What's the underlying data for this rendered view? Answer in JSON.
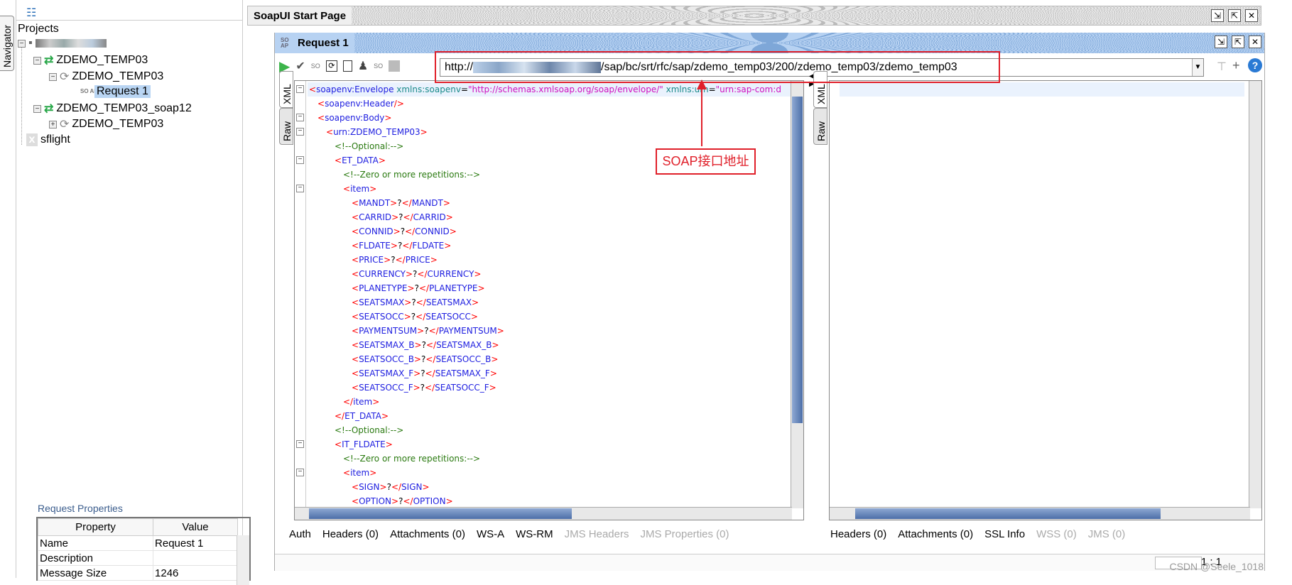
{
  "navigator": {
    "tab_label": "Navigator",
    "projects_label": "Projects",
    "tree": [
      {
        "label": "",
        "icon": "project-icon",
        "blurred": true
      },
      {
        "label": "ZDEMO_TEMP03",
        "icon": "interface-icon"
      },
      {
        "label": "ZDEMO_TEMP03",
        "icon": "operation-icon"
      },
      {
        "label": "Request 1",
        "icon": "soap-request-icon",
        "selected": true
      },
      {
        "label": "ZDEMO_TEMP03_soap12",
        "icon": "interface-icon"
      },
      {
        "label": "ZDEMO_TEMP03",
        "icon": "operation-icon"
      },
      {
        "label": "sflight",
        "icon": "closed-project-icon"
      }
    ]
  },
  "properties": {
    "title": "Request Properties",
    "headers": [
      "Property",
      "Value"
    ],
    "rows": [
      [
        "Name",
        "Request 1"
      ],
      [
        "Description",
        ""
      ],
      [
        "Message Size",
        "1246"
      ]
    ]
  },
  "start_page": {
    "title": "SoapUI Start Page"
  },
  "request": {
    "title": "Request 1",
    "soap_badge": "SO AP",
    "url_prefix": "http://",
    "url_suffix": "/sap/bc/srt/rfc/sap/zdemo_temp03/200/zdemo_temp03/zdemo_temp03",
    "annotation": "SOAP接口地址",
    "annotation_color": "#e0202a",
    "left_vtabs": [
      "XML",
      "Raw"
    ],
    "right_vtabs": [
      "XML",
      "Raw"
    ],
    "xml_lines": [
      {
        "indent": 0,
        "fold": true,
        "tokens": [
          [
            "b",
            "<"
          ],
          [
            "n",
            "soapenv:Envelope "
          ],
          [
            "a",
            "xmlns:soapenv"
          ],
          [
            "x",
            "="
          ],
          [
            "v",
            "\"http://schemas.xmlsoap.org/soap/envelope/\" "
          ],
          [
            "a",
            "xmlns:urn"
          ],
          [
            "x",
            "="
          ],
          [
            "v",
            "\"urn:sap-com:d"
          ]
        ]
      },
      {
        "indent": 1,
        "fold": false,
        "tokens": [
          [
            "b",
            "<"
          ],
          [
            "n",
            "soapenv:Header"
          ],
          [
            "b",
            "/>"
          ]
        ]
      },
      {
        "indent": 1,
        "fold": true,
        "tokens": [
          [
            "b",
            "<"
          ],
          [
            "n",
            "soapenv:Body"
          ],
          [
            "b",
            ">"
          ]
        ]
      },
      {
        "indent": 2,
        "fold": true,
        "tokens": [
          [
            "b",
            "<"
          ],
          [
            "n",
            "urn:ZDEMO_TEMP03"
          ],
          [
            "b",
            ">"
          ]
        ]
      },
      {
        "indent": 3,
        "fold": false,
        "tokens": [
          [
            "c",
            "<!--Optional:-->"
          ]
        ]
      },
      {
        "indent": 3,
        "fold": true,
        "tokens": [
          [
            "b",
            "<"
          ],
          [
            "n",
            "ET_DATA"
          ],
          [
            "b",
            ">"
          ]
        ]
      },
      {
        "indent": 4,
        "fold": false,
        "tokens": [
          [
            "c",
            "<!--Zero or more repetitions:-->"
          ]
        ]
      },
      {
        "indent": 4,
        "fold": true,
        "tokens": [
          [
            "b",
            "<"
          ],
          [
            "n",
            "item"
          ],
          [
            "b",
            ">"
          ]
        ]
      },
      {
        "indent": 5,
        "fold": false,
        "tokens": [
          [
            "b",
            "<"
          ],
          [
            "n",
            "MANDT"
          ],
          [
            "b",
            ">"
          ],
          [
            "x",
            "?"
          ],
          [
            "b",
            "</"
          ],
          [
            "n",
            "MANDT"
          ],
          [
            "b",
            ">"
          ]
        ]
      },
      {
        "indent": 5,
        "fold": false,
        "tokens": [
          [
            "b",
            "<"
          ],
          [
            "n",
            "CARRID"
          ],
          [
            "b",
            ">"
          ],
          [
            "x",
            "?"
          ],
          [
            "b",
            "</"
          ],
          [
            "n",
            "CARRID"
          ],
          [
            "b",
            ">"
          ]
        ]
      },
      {
        "indent": 5,
        "fold": false,
        "tokens": [
          [
            "b",
            "<"
          ],
          [
            "n",
            "CONNID"
          ],
          [
            "b",
            ">"
          ],
          [
            "x",
            "?"
          ],
          [
            "b",
            "</"
          ],
          [
            "n",
            "CONNID"
          ],
          [
            "b",
            ">"
          ]
        ]
      },
      {
        "indent": 5,
        "fold": false,
        "tokens": [
          [
            "b",
            "<"
          ],
          [
            "n",
            "FLDATE"
          ],
          [
            "b",
            ">"
          ],
          [
            "x",
            "?"
          ],
          [
            "b",
            "</"
          ],
          [
            "n",
            "FLDATE"
          ],
          [
            "b",
            ">"
          ]
        ]
      },
      {
        "indent": 5,
        "fold": false,
        "tokens": [
          [
            "b",
            "<"
          ],
          [
            "n",
            "PRICE"
          ],
          [
            "b",
            ">"
          ],
          [
            "x",
            "?"
          ],
          [
            "b",
            "</"
          ],
          [
            "n",
            "PRICE"
          ],
          [
            "b",
            ">"
          ]
        ]
      },
      {
        "indent": 5,
        "fold": false,
        "tokens": [
          [
            "b",
            "<"
          ],
          [
            "n",
            "CURRENCY"
          ],
          [
            "b",
            ">"
          ],
          [
            "x",
            "?"
          ],
          [
            "b",
            "</"
          ],
          [
            "n",
            "CURRENCY"
          ],
          [
            "b",
            ">"
          ]
        ]
      },
      {
        "indent": 5,
        "fold": false,
        "tokens": [
          [
            "b",
            "<"
          ],
          [
            "n",
            "PLANETYPE"
          ],
          [
            "b",
            ">"
          ],
          [
            "x",
            "?"
          ],
          [
            "b",
            "</"
          ],
          [
            "n",
            "PLANETYPE"
          ],
          [
            "b",
            ">"
          ]
        ]
      },
      {
        "indent": 5,
        "fold": false,
        "tokens": [
          [
            "b",
            "<"
          ],
          [
            "n",
            "SEATSMAX"
          ],
          [
            "b",
            ">"
          ],
          [
            "x",
            "?"
          ],
          [
            "b",
            "</"
          ],
          [
            "n",
            "SEATSMAX"
          ],
          [
            "b",
            ">"
          ]
        ]
      },
      {
        "indent": 5,
        "fold": false,
        "tokens": [
          [
            "b",
            "<"
          ],
          [
            "n",
            "SEATSOCC"
          ],
          [
            "b",
            ">"
          ],
          [
            "x",
            "?"
          ],
          [
            "b",
            "</"
          ],
          [
            "n",
            "SEATSOCC"
          ],
          [
            "b",
            ">"
          ]
        ]
      },
      {
        "indent": 5,
        "fold": false,
        "tokens": [
          [
            "b",
            "<"
          ],
          [
            "n",
            "PAYMENTSUM"
          ],
          [
            "b",
            ">"
          ],
          [
            "x",
            "?"
          ],
          [
            "b",
            "</"
          ],
          [
            "n",
            "PAYMENTSUM"
          ],
          [
            "b",
            ">"
          ]
        ]
      },
      {
        "indent": 5,
        "fold": false,
        "tokens": [
          [
            "b",
            "<"
          ],
          [
            "n",
            "SEATSMAX_B"
          ],
          [
            "b",
            ">"
          ],
          [
            "x",
            "?"
          ],
          [
            "b",
            "</"
          ],
          [
            "n",
            "SEATSMAX_B"
          ],
          [
            "b",
            ">"
          ]
        ]
      },
      {
        "indent": 5,
        "fold": false,
        "tokens": [
          [
            "b",
            "<"
          ],
          [
            "n",
            "SEATSOCC_B"
          ],
          [
            "b",
            ">"
          ],
          [
            "x",
            "?"
          ],
          [
            "b",
            "</"
          ],
          [
            "n",
            "SEATSOCC_B"
          ],
          [
            "b",
            ">"
          ]
        ]
      },
      {
        "indent": 5,
        "fold": false,
        "tokens": [
          [
            "b",
            "<"
          ],
          [
            "n",
            "SEATSMAX_F"
          ],
          [
            "b",
            ">"
          ],
          [
            "x",
            "?"
          ],
          [
            "b",
            "</"
          ],
          [
            "n",
            "SEATSMAX_F"
          ],
          [
            "b",
            ">"
          ]
        ]
      },
      {
        "indent": 5,
        "fold": false,
        "tokens": [
          [
            "b",
            "<"
          ],
          [
            "n",
            "SEATSOCC_F"
          ],
          [
            "b",
            ">"
          ],
          [
            "x",
            "?"
          ],
          [
            "b",
            "</"
          ],
          [
            "n",
            "SEATSOCC_F"
          ],
          [
            "b",
            ">"
          ]
        ]
      },
      {
        "indent": 4,
        "fold": false,
        "tokens": [
          [
            "b",
            "</"
          ],
          [
            "n",
            "item"
          ],
          [
            "b",
            ">"
          ]
        ]
      },
      {
        "indent": 3,
        "fold": false,
        "tokens": [
          [
            "b",
            "</"
          ],
          [
            "n",
            "ET_DATA"
          ],
          [
            "b",
            ">"
          ]
        ]
      },
      {
        "indent": 3,
        "fold": false,
        "tokens": [
          [
            "c",
            "<!--Optional:-->"
          ]
        ]
      },
      {
        "indent": 3,
        "fold": true,
        "tokens": [
          [
            "b",
            "<"
          ],
          [
            "n",
            "IT_FLDATE"
          ],
          [
            "b",
            ">"
          ]
        ]
      },
      {
        "indent": 4,
        "fold": false,
        "tokens": [
          [
            "c",
            "<!--Zero or more repetitions:-->"
          ]
        ]
      },
      {
        "indent": 4,
        "fold": true,
        "tokens": [
          [
            "b",
            "<"
          ],
          [
            "n",
            "item"
          ],
          [
            "b",
            ">"
          ]
        ]
      },
      {
        "indent": 5,
        "fold": false,
        "tokens": [
          [
            "b",
            "<"
          ],
          [
            "n",
            "SIGN"
          ],
          [
            "b",
            ">"
          ],
          [
            "x",
            "?"
          ],
          [
            "b",
            "</"
          ],
          [
            "n",
            "SIGN"
          ],
          [
            "b",
            ">"
          ]
        ]
      },
      {
        "indent": 5,
        "fold": false,
        "tokens": [
          [
            "b",
            "<"
          ],
          [
            "n",
            "OPTION"
          ],
          [
            "b",
            ">"
          ],
          [
            "x",
            "?"
          ],
          [
            "b",
            "</"
          ],
          [
            "n",
            "OPTION"
          ],
          [
            "b",
            ">"
          ]
        ]
      }
    ],
    "request_tabs": [
      {
        "label": "Auth",
        "enabled": true
      },
      {
        "label": "Headers (0)",
        "enabled": true
      },
      {
        "label": "Attachments (0)",
        "enabled": true
      },
      {
        "label": "WS-A",
        "enabled": true
      },
      {
        "label": "WS-RM",
        "enabled": true
      },
      {
        "label": "JMS Headers",
        "enabled": false
      },
      {
        "label": "JMS Properties (0)",
        "enabled": false
      }
    ],
    "response_tabs": [
      {
        "label": "Headers (0)",
        "enabled": true
      },
      {
        "label": "Attachments (0)",
        "enabled": true
      },
      {
        "label": "SSL Info",
        "enabled": true
      },
      {
        "label": "WSS (0)",
        "enabled": false
      },
      {
        "label": "JMS (0)",
        "enabled": false
      }
    ],
    "cursor_position": "1 : 1"
  },
  "watermark": "CSDN @Seele_1018"
}
